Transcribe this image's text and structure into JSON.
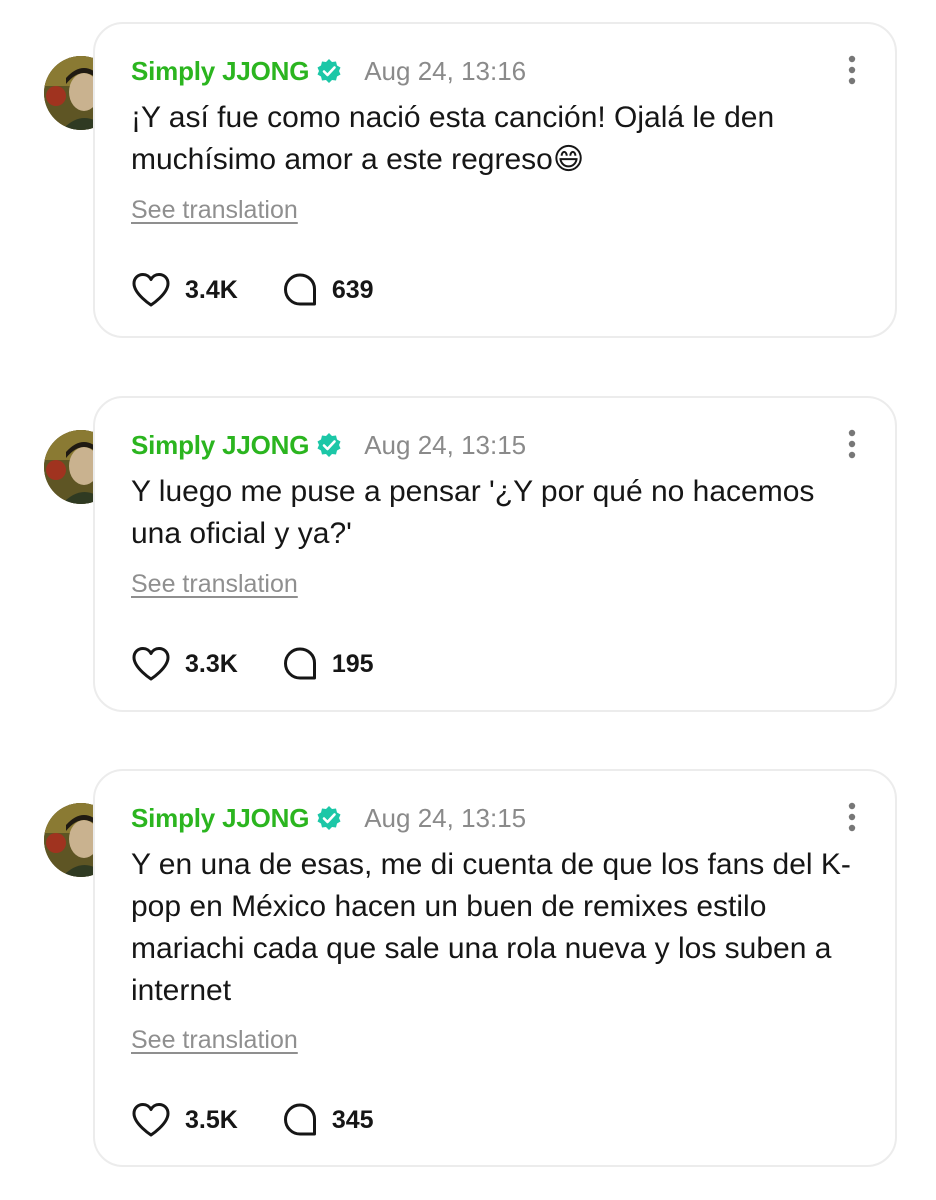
{
  "posts": [
    {
      "author": "Simply JJONG",
      "timestamp": "Aug 24, 13:16",
      "body": "¡Y así fue como nació esta canción! Ojalá le den muchísimo amor a este regreso😄",
      "see_translation": "See translation",
      "likes": "3.4K",
      "comments": "639"
    },
    {
      "author": "Simply JJONG",
      "timestamp": "Aug 24, 13:15",
      "body": "Y luego me puse a pensar '¿Y por qué no hacemos una oficial y ya?'",
      "see_translation": "See translation",
      "likes": "3.3K",
      "comments": "195"
    },
    {
      "author": "Simply JJONG",
      "timestamp": "Aug 24, 13:15",
      "body": "Y en una de esas, me di cuenta de que los fans del K-pop en México hacen un buen de remixes estilo mariachi cada que sale una rola nueva y los suben a internet",
      "see_translation": "See translation",
      "likes": "3.5K",
      "comments": "345"
    }
  ],
  "icons": {
    "verified": "verified-badge-icon",
    "more": "more-vertical-icon",
    "like": "heart-icon",
    "comment": "comment-bubble-icon"
  },
  "colors": {
    "author": "#2bb51f",
    "verified": "#1cc7a7",
    "timestamp": "#8a8a8a",
    "card_border": "#ececec"
  }
}
